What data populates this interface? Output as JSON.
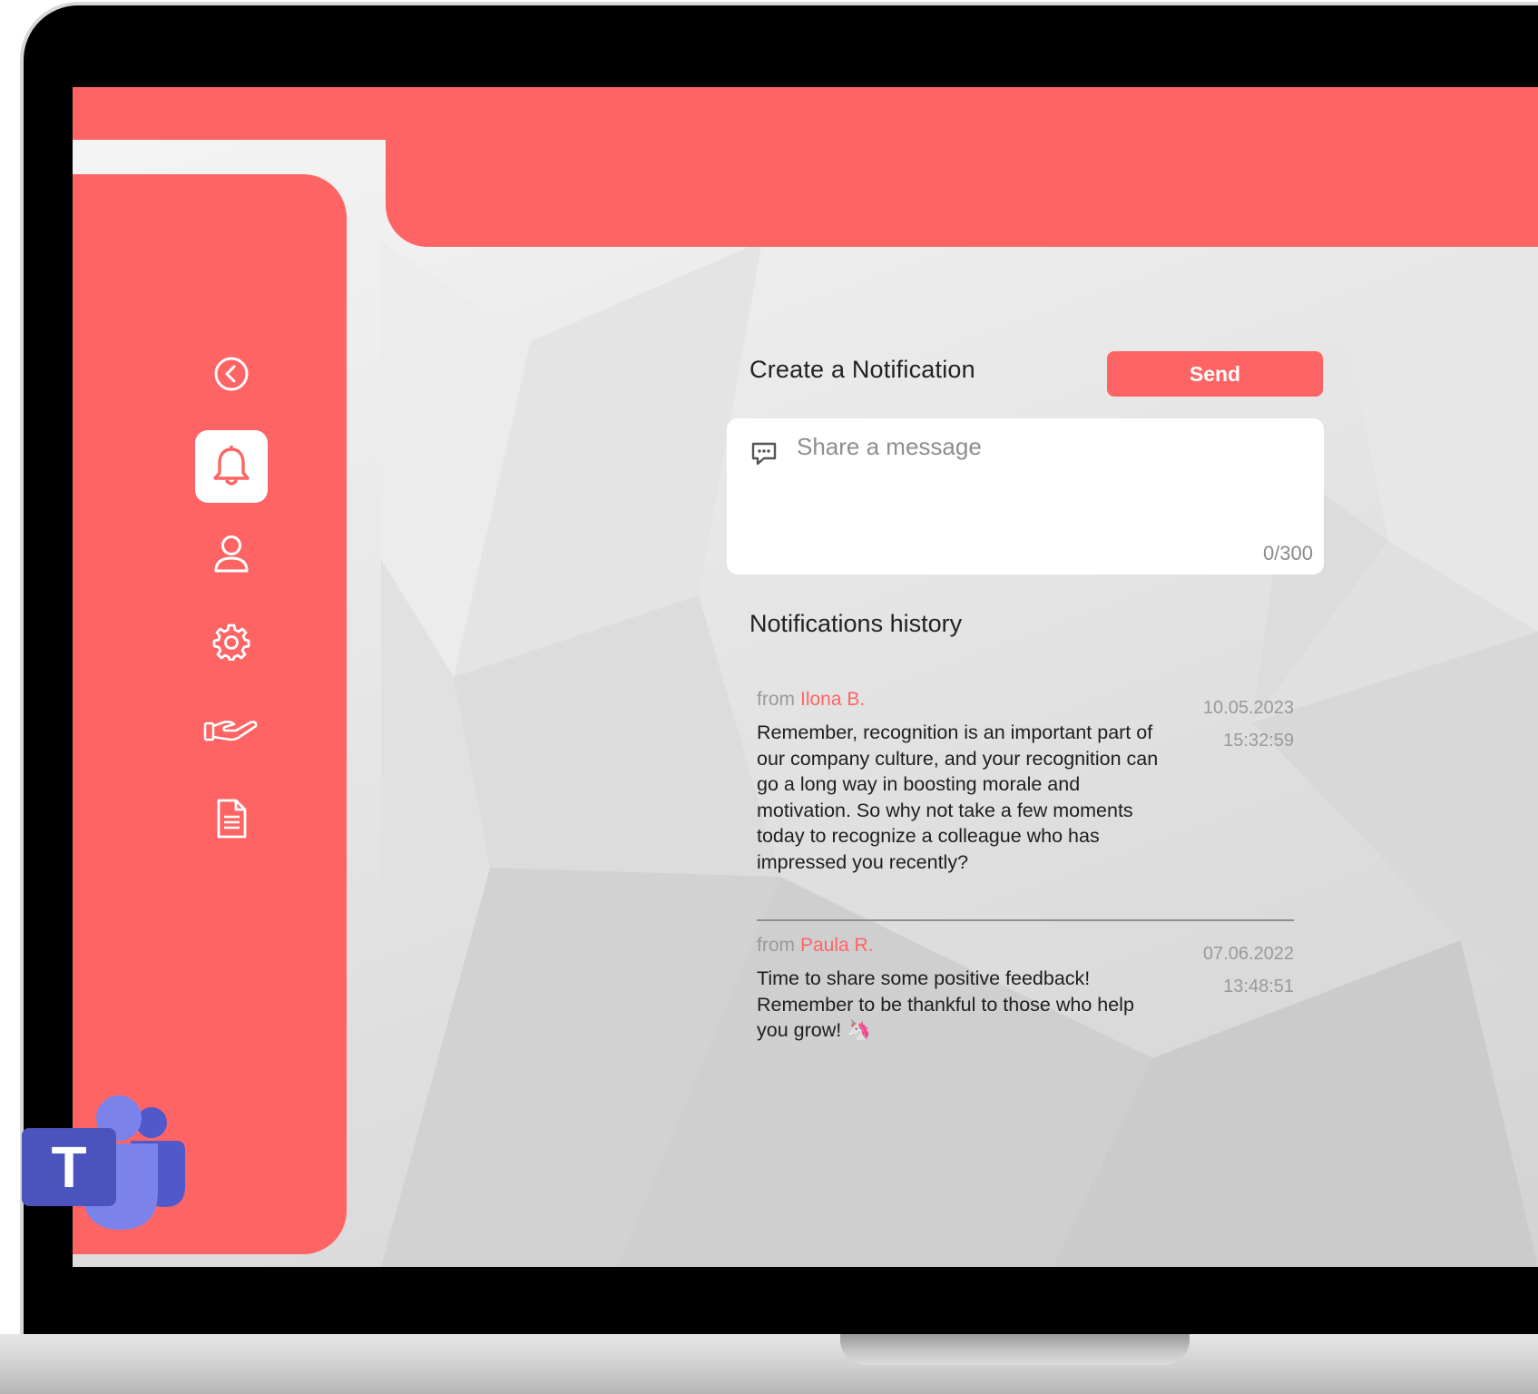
{
  "sidebar": {
    "items": [
      {
        "icon": "back-icon"
      },
      {
        "icon": "bell-icon",
        "active": true
      },
      {
        "icon": "user-icon"
      },
      {
        "icon": "gear-icon"
      },
      {
        "icon": "giving-hand-icon"
      },
      {
        "icon": "document-icon"
      }
    ]
  },
  "compose": {
    "title": "Create a Notification",
    "send_label": "Send",
    "placeholder": "Share a message",
    "counter": "0/300"
  },
  "history": {
    "title": "Notifications history",
    "from_label": "from",
    "items": [
      {
        "author": "Ilona B.",
        "date": "10.05.2023",
        "time": "15:32:59",
        "message": "Remember, recognition is an important part of our company culture, and your recognition can go a long way in boosting morale and motivation. So why not take a few moments today to recognize a colleague who has impressed you recently?"
      },
      {
        "author": "Paula R.",
        "date": "07.06.2022",
        "time": "13:48:51",
        "message": "Time to share some positive feedback! Remember to be thankful to those who help you grow! 🦄"
      }
    ]
  },
  "colors": {
    "accent": "#ff6464",
    "teams_purple": "#5059c9"
  }
}
